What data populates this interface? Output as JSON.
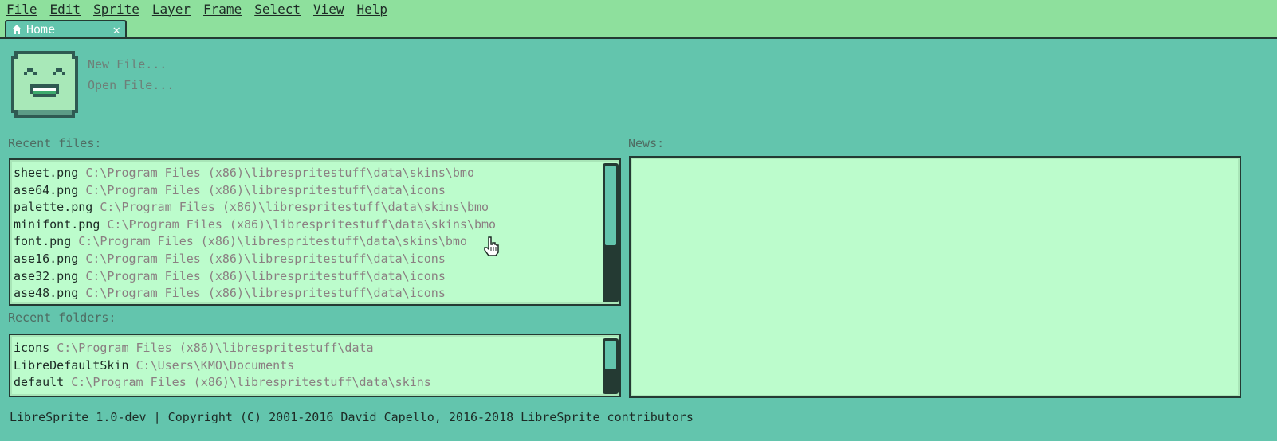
{
  "menu": [
    "File",
    "Edit",
    "Sprite",
    "Layer",
    "Frame",
    "Select",
    "View",
    "Help"
  ],
  "tab": {
    "label": "Home",
    "icon": "home-icon",
    "close": "✕"
  },
  "actions": {
    "new_file": "New File...",
    "open_file": "Open File..."
  },
  "recent_files": {
    "label": "Recent files:",
    "items": [
      {
        "name": "sheet.png",
        "path": "C:\\Program Files (x86)\\librespritestuff\\data\\skins\\bmo"
      },
      {
        "name": "ase64.png",
        "path": "C:\\Program Files (x86)\\librespritestuff\\data\\icons"
      },
      {
        "name": "palette.png",
        "path": "C:\\Program Files (x86)\\librespritestuff\\data\\skins\\bmo"
      },
      {
        "name": "minifont.png",
        "path": "C:\\Program Files (x86)\\librespritestuff\\data\\skins\\bmo"
      },
      {
        "name": "font.png",
        "path": "C:\\Program Files (x86)\\librespritestuff\\data\\skins\\bmo"
      },
      {
        "name": "ase16.png",
        "path": "C:\\Program Files (x86)\\librespritestuff\\data\\icons"
      },
      {
        "name": "ase32.png",
        "path": "C:\\Program Files (x86)\\librespritestuff\\data\\icons"
      },
      {
        "name": "ase48.png",
        "path": "C:\\Program Files (x86)\\librespritestuff\\data\\icons"
      }
    ]
  },
  "recent_folders": {
    "label": "Recent folders:",
    "items": [
      {
        "name": "icons",
        "path": "C:\\Program Files (x86)\\librespritestuff\\data"
      },
      {
        "name": "LibreDefaultSkin",
        "path": "C:\\Users\\KMO\\Documents"
      },
      {
        "name": "default",
        "path": "C:\\Program Files (x86)\\librespritestuff\\data\\skins"
      }
    ]
  },
  "news": {
    "label": "News:"
  },
  "status": "LibreSprite 1.0-dev | Copyright (C) 2001-2016 David Capello, 2016-2018 LibreSprite contributors",
  "colors": {
    "background": "#63c5ad",
    "menubar": "#8ee09d",
    "panel": "#bcfccc",
    "border": "#243a33"
  }
}
